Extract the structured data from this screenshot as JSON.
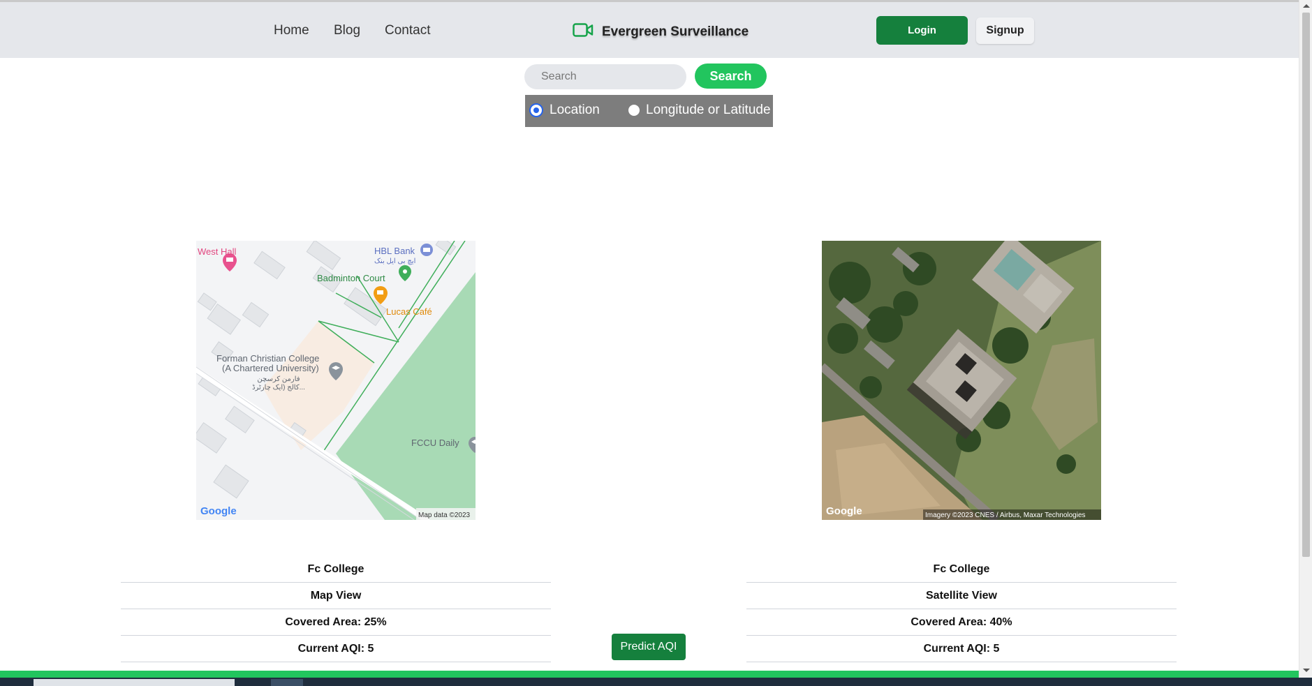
{
  "nav": {
    "links": [
      "Home",
      "Blog",
      "Contact"
    ],
    "brand": "Evergreen Surveillance",
    "login": "Login",
    "signup": "Signup"
  },
  "search": {
    "placeholder": "Search",
    "button": "Search",
    "options": [
      "Location",
      "Longitude or Latitude"
    ],
    "selected": "Location"
  },
  "map_view": {
    "labels": {
      "west_hall": "West Hall",
      "hbl_bank": "HBL Bank",
      "hbl_bank_urdu": "ایچ بی ایل بنک",
      "badminton": "Badminton Court",
      "lucas": "Lucas Café",
      "fccu_line1": "Forman Christian College",
      "fccu_line2": "(A Chartered University)",
      "fccu_urdu1": "فارمن کرسچن",
      "fccu_urdu2": "کالج (ایک چارٹرڈ...",
      "fccu_daily": "FCCU Daily",
      "google": "Google",
      "attribution": "Map data ©2023"
    },
    "info": [
      "Fc College",
      "Map View",
      "Covered Area: 25%",
      "Current AQI: 5"
    ]
  },
  "satellite_view": {
    "google": "Google",
    "attribution": "Imagery ©2023 CNES / Airbus, Maxar Technologies",
    "info": [
      "Fc College",
      "Satellite View",
      "Covered Area: 40%",
      "Current AQI: 5"
    ]
  },
  "predict_button": "Predict AQI",
  "colors": {
    "primary": "#15803d",
    "accent": "#22c55e",
    "nav_bg": "#e5e7eb",
    "radio_bg": "#7d7d7d"
  }
}
